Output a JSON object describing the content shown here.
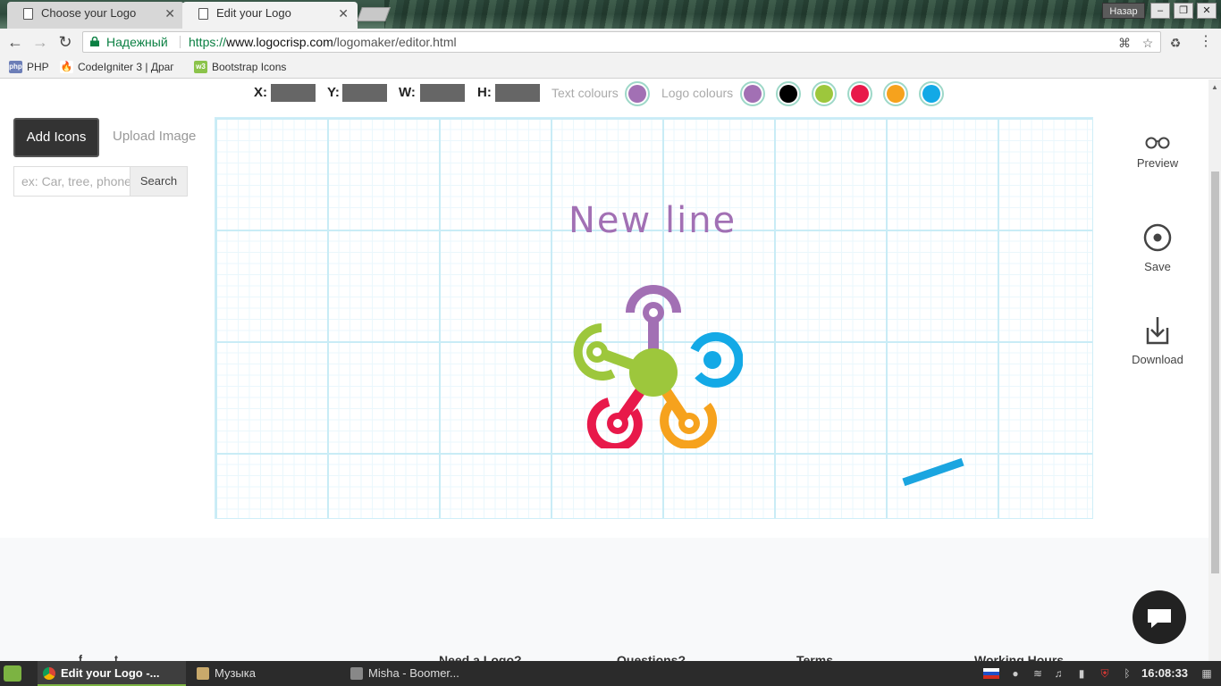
{
  "browser": {
    "tabs": [
      {
        "title": "Choose your Logo"
      },
      {
        "title": "Edit your Logo"
      }
    ],
    "window_back_label": "Назар",
    "secure_label": "Надежный",
    "url": {
      "scheme": "https://",
      "host": "www.logocrisp.com",
      "path": "/logomaker/editor.html"
    },
    "bookmarks": [
      {
        "label": "PHP",
        "icon": "php-icon"
      },
      {
        "label": "CodeIgniter 3 | Драг",
        "icon": "codeigniter-icon"
      },
      {
        "label": "Bootstrap Icons",
        "icon": "bootstrap-icon"
      }
    ]
  },
  "editor": {
    "props": {
      "x_label": "X:",
      "y_label": "Y:",
      "w_label": "W:",
      "h_label": "H:"
    },
    "text_colours_label": "Text colours",
    "logo_colours_label": "Logo colours",
    "text_colours": [
      "#a270b4"
    ],
    "logo_colours": [
      "#a270b4",
      "#000000",
      "#9dc73c",
      "#e8194a",
      "#f6a21d",
      "#13a9e6"
    ],
    "add_icons_label": "Add Icons",
    "upload_image_label": "Upload Image",
    "search_placeholder": "ex: Car, tree, phone",
    "search_button": "Search",
    "canvas_text": "New line",
    "tools": [
      {
        "label": "Preview",
        "icon": "glasses-icon"
      },
      {
        "label": "Save",
        "icon": "target-icon"
      },
      {
        "label": "Download",
        "icon": "download-icon"
      }
    ]
  },
  "footer": {
    "columns": [
      "Need a Logo?",
      "Questions?",
      "Terms",
      "Working Hours"
    ]
  },
  "taskbar": {
    "tasks": [
      {
        "label": "Edit your Logo -...",
        "icon": "chrome-icon"
      },
      {
        "label": "Музыка",
        "icon": "folder-icon"
      },
      {
        "label": "Misha - Boomer...",
        "icon": "media-player-icon"
      }
    ],
    "clock": "16:08:33"
  }
}
